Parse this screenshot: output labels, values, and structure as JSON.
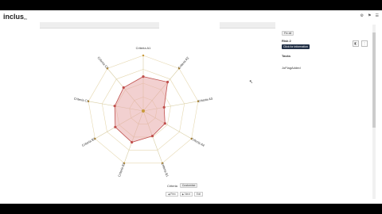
{
  "app": {
    "logo": "inclus",
    "logo_suffix": "ec"
  },
  "header": {
    "icons": [
      "settings-icon",
      "flag-icon",
      "menu-icon"
    ]
  },
  "panel": {
    "top_pill": "Fix all",
    "risk_title": "Risk 2",
    "tooltip": "Click for information",
    "tasks_label": "Tasks",
    "assigned_label": "JoFlagAdded"
  },
  "controls": {
    "btn1": "◧",
    "btn2": "⋮"
  },
  "radar": {
    "axes": [
      "Criteria A1",
      "Criteria A2",
      "Criteria A3",
      "Criteria A4",
      "Criteria B1",
      "Criteria B2",
      "Criteria B3",
      "Criteria C1",
      "Criteria C2"
    ],
    "color_fill": "#e8a9a9",
    "color_stroke": "#c0504d",
    "values": [
      0.62,
      0.68,
      0.38,
      0.45,
      0.48,
      0.6,
      0.58,
      0.52,
      0.55
    ]
  },
  "bottom": {
    "label": "Criteria",
    "pill": "Customise",
    "btn_a": "◀ Prev",
    "btn_b": "▶ Next",
    "btn_c": "Exit"
  }
}
